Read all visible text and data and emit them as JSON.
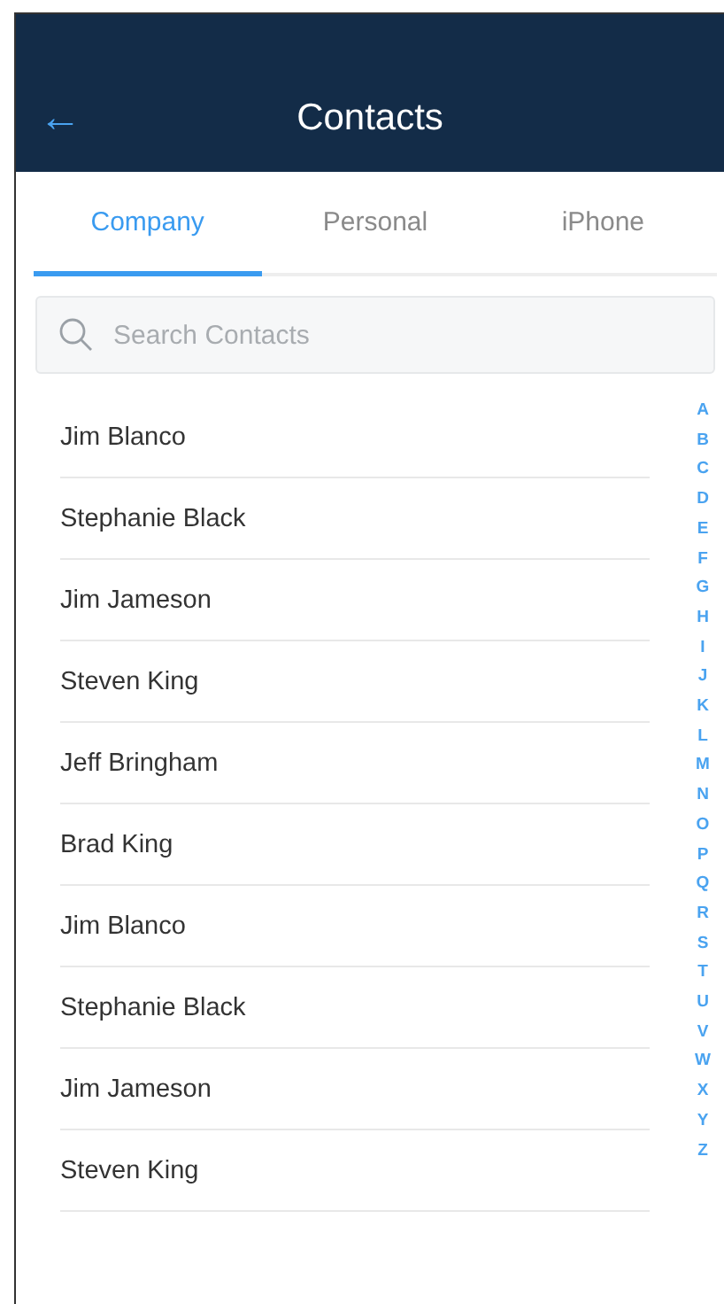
{
  "header": {
    "back": "←",
    "title": "Contacts"
  },
  "tabs": [
    {
      "label": "Company",
      "selected": true
    },
    {
      "label": "Personal",
      "selected": false
    },
    {
      "label": "iPhone",
      "selected": false
    }
  ],
  "search": {
    "placeholder": "Search Contacts"
  },
  "contacts": [
    "Jim Blanco",
    "Stephanie Black",
    "Jim Jameson",
    "Steven King",
    "Jeff Bringham",
    "Brad King",
    "Jim Blanco",
    "Stephanie Black",
    "Jim Jameson",
    "Steven King"
  ],
  "index": [
    "A",
    "B",
    "C",
    "D",
    "E",
    "F",
    "G",
    "H",
    "I",
    "J",
    "K",
    "L",
    "M",
    "N",
    "O",
    "P",
    "Q",
    "R",
    "S",
    "T",
    "U",
    "V",
    "W",
    "X",
    "Y",
    "Z"
  ]
}
